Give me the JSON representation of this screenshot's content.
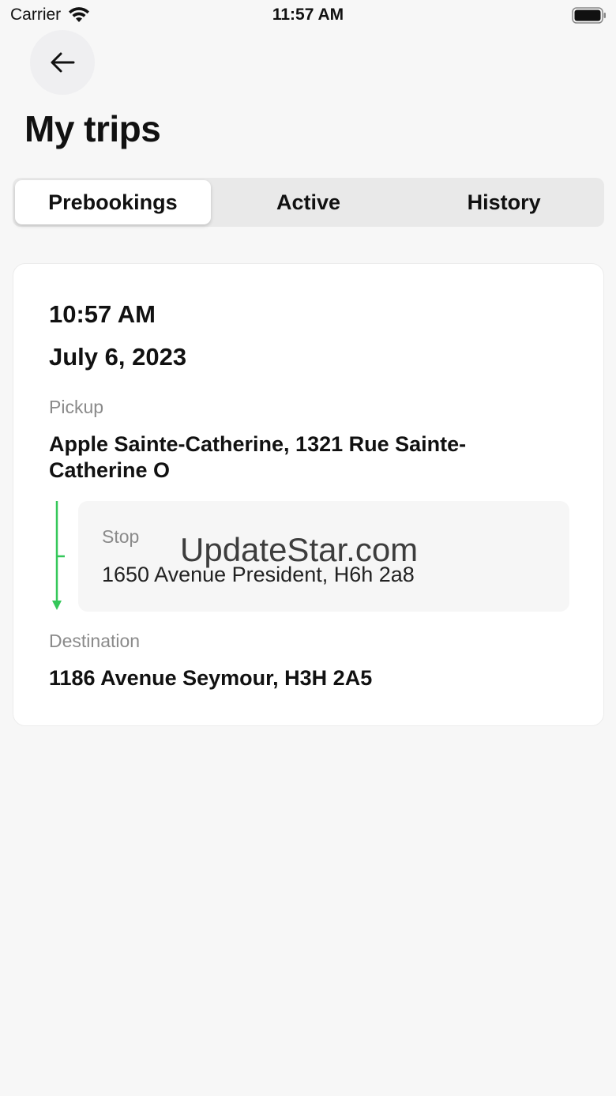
{
  "status_bar": {
    "carrier": "Carrier",
    "time": "11:57 AM",
    "wifi_icon": "wifi-icon",
    "battery_icon": "battery-icon"
  },
  "header": {
    "back_icon": "arrow-left-icon",
    "title": "My trips"
  },
  "tabs": [
    {
      "label": "Prebookings",
      "selected": true
    },
    {
      "label": "Active",
      "selected": false
    },
    {
      "label": "History",
      "selected": false
    }
  ],
  "trip": {
    "time": "10:57 AM",
    "date": "July 6, 2023",
    "pickup_label": "Pickup",
    "pickup_address": "Apple Sainte-Catherine, 1321 Rue Sainte-Catherine O",
    "stop_label": "Stop",
    "stop_address": "1650 Avenue President, H6h 2a8",
    "destination_label": "Destination",
    "destination_address": "1186 Avenue Seymour, H3H 2A5",
    "route_color": "#34c759"
  },
  "watermark": "UpdateStar.com"
}
